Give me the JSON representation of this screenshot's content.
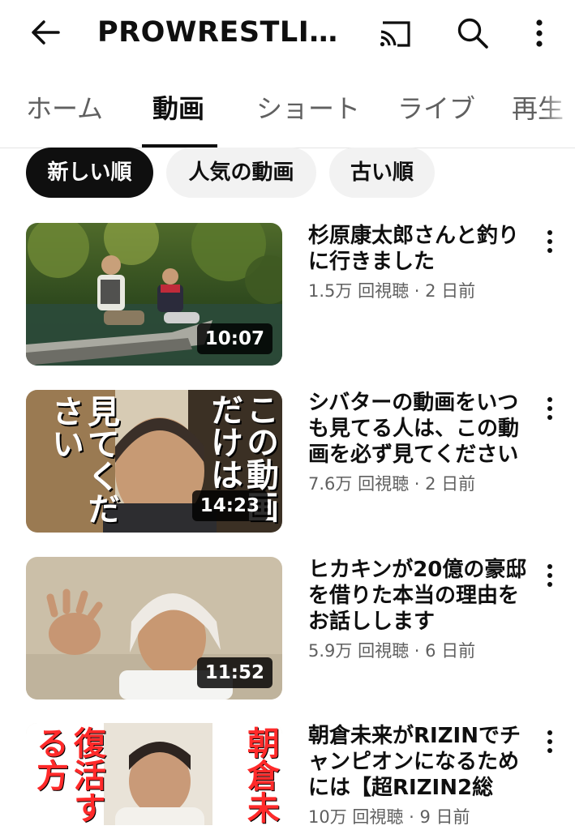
{
  "header": {
    "channel_title": "PROWRESTLIN...",
    "back_icon": "arrow-left-icon",
    "cast_icon": "cast-icon",
    "search_icon": "search-icon",
    "more_icon": "more-vert-icon"
  },
  "tabs": [
    {
      "label": "ホーム"
    },
    {
      "label": "動画"
    },
    {
      "label": "ショート"
    },
    {
      "label": "ライブ"
    },
    {
      "label": "再生"
    }
  ],
  "chips": [
    {
      "label": "新しい順"
    },
    {
      "label": "人気の動画"
    },
    {
      "label": "古い順"
    }
  ],
  "videos": [
    {
      "title": "杉原康太郎さんと釣りに行きました",
      "views": "1.5万 回視聴",
      "age": "2 日前",
      "duration": "10:07"
    },
    {
      "title": "シバターの動画をいつも見てる人は、この動画を必ず見てください",
      "views": "7.6万 回視聴",
      "age": "2 日前",
      "duration": "14:23",
      "thumb_text": [
        "見て",
        "ください",
        "この動画",
        "だけは"
      ]
    },
    {
      "title": "ヒカキンが20億の豪邸を借りた本当の理由をお話しします",
      "views": "5.9万 回視聴",
      "age": "6 日前",
      "duration": "11:52"
    },
    {
      "title": "朝倉未来がRIZINでチャンピオンになるためには【超RIZIN2総",
      "views": "10万 回視聴",
      "age": "9 日前",
      "thumb_text": [
        "復活",
        "する方",
        "朝倉未"
      ]
    }
  ],
  "colors": {
    "chip_selected_bg": "#0f0f0f",
    "chip_bg": "#f2f2f2",
    "secondary_text": "#606060"
  }
}
